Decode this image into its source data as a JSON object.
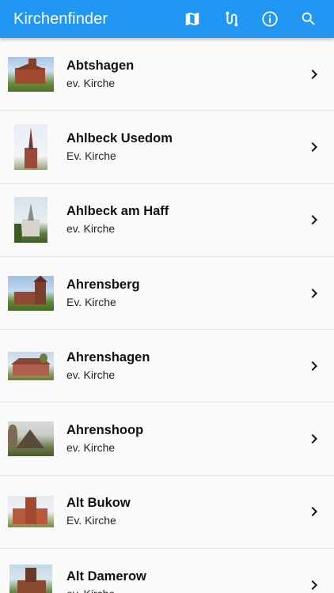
{
  "app": {
    "title": "Kirchenfinder",
    "accent": "#2196f3",
    "actions": [
      "map-icon",
      "route-icon",
      "info-icon",
      "search-icon"
    ]
  },
  "churches": [
    {
      "name": "Abtshagen",
      "type": "ev. Kirche"
    },
    {
      "name": "Ahlbeck Usedom",
      "type": "Ev. Kirche"
    },
    {
      "name": "Ahlbeck am Haff",
      "type": "ev. Kirche"
    },
    {
      "name": "Ahrensberg",
      "type": "Ev. Kirche"
    },
    {
      "name": "Ahrenshagen",
      "type": "ev. Kirche"
    },
    {
      "name": "Ahrenshoop",
      "type": "ev. Kirche"
    },
    {
      "name": "Alt Bukow",
      "type": "Ev. Kirche"
    },
    {
      "name": "Alt Damerow",
      "type": "ev. Kirche"
    }
  ]
}
